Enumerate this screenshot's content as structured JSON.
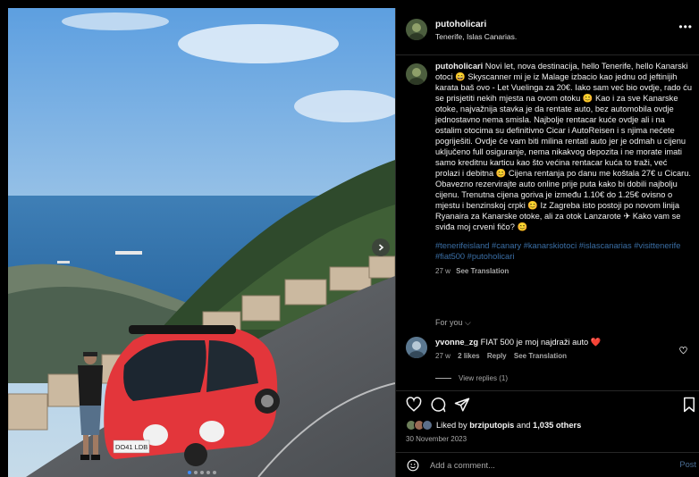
{
  "post": {
    "username": "putoholicari",
    "location": "Tenerife, Islas Canarias.",
    "more_icon": "more-horizontal-icon"
  },
  "photo": {
    "car_plate": "DO41 LDB",
    "carousel_count": 5,
    "carousel_active": 1
  },
  "caption": {
    "username": "putoholicari",
    "text": "Novi let, nova destinacija, hello Tenerife, hello Kanarski otoci 😄 Skyscanner mi je iz Malage izbacio kao jednu od jeftinijih karata baš ovo - Let Vuelinga za 20€. Iako sam već bio ovdje, rado ću se prisjetiti nekih mjesta na ovom otoku 😊 Kao i za sve Kanarske otoke, najvažnija stavka je da rentate auto, bez automobila ovdje jednostavno nema smisla. Najbolje rentacar kuće ovdje ali i na ostalim otocima su definitivno Cicar i AutoReisen i s njima nećete pogriješiti. Ovdje će vam biti milina rentati auto jer je odmah u cijenu uključeno full osiguranje, nema nikakvog depozita i ne morate imati samo kreditnu karticu kao što većina rentacar kuća to traži, već prolazi i debitna 😊 Cijena rentanja po danu me koštala 27€ u Cicaru. Obavezno rezervirajte auto online prije puta kako bi dobili najbolju cijenu. Trenutna cijena goriva je između 1.10€ do 1.25€ ovisno o mjestu i benzinskoj crpki 😊 Iz Zagreba isto postoji po novom linija Ryanaira za Kanarske otoke, ali za otok Lanzarote ✈ Kako vam se sviđa moj crveni fičo? 😊",
    "hashtags": "#tenerifeisland #canary #kanarskiotoci #islascanarias #visittenerife #fiat500 #putoholicari",
    "age": "27 w",
    "see_translation": "See Translation"
  },
  "for_you": "For you ⌵",
  "comment": {
    "username": "yvonne_zg",
    "text": "FIAT 500 je moj najdraži auto ❤️",
    "age": "27 w",
    "likes": "2 likes",
    "reply": "Reply",
    "see_translation": "See Translation",
    "view_replies": "View replies (1)"
  },
  "actions": {
    "like_icon": "heart-icon",
    "comment_icon": "comment-icon",
    "share_icon": "send-icon",
    "save_icon": "bookmark-icon"
  },
  "likes": {
    "prefix": "Liked by",
    "user": "brziputopis",
    "suffix": "and",
    "others": "1,035 others"
  },
  "date": "30 November 2023",
  "add_comment": {
    "placeholder": "Add a comment...",
    "post_label": "Post"
  }
}
